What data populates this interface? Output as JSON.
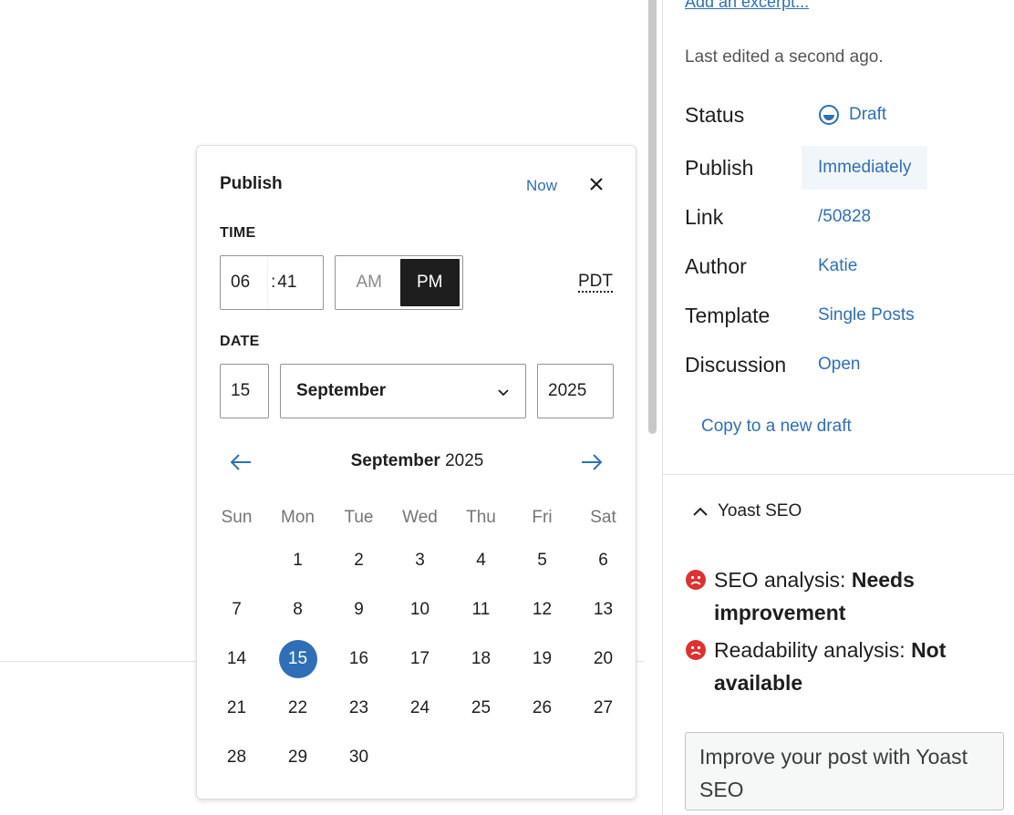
{
  "sidebar": {
    "excerpt_link": "Add an excerpt...",
    "last_edited": "Last edited a second ago.",
    "rows": [
      {
        "label": "Status",
        "value": "Draft"
      },
      {
        "label": "Publish",
        "value": "Immediately"
      },
      {
        "label": "Link",
        "value": "/50828"
      },
      {
        "label": "Author",
        "value": "Katie"
      },
      {
        "label": "Template",
        "value": "Single Posts"
      },
      {
        "label": "Discussion",
        "value": "Open"
      }
    ],
    "copy_draft": "Copy to a new draft",
    "yoast": {
      "title": "Yoast SEO",
      "seo_prefix": "SEO analysis: ",
      "seo_value": "Needs improvement",
      "readability_prefix": "Readability analysis: ",
      "readability_value": "Not available",
      "improve_button": "Improve your post with Yoast SEO"
    }
  },
  "popover": {
    "title": "Publish",
    "now": "Now",
    "time_label": "TIME",
    "hour": "06",
    "minute": "41",
    "am": "AM",
    "pm": "PM",
    "selected_period": "PM",
    "timezone": "PDT",
    "date_label": "DATE",
    "day": "15",
    "month": "September",
    "year": "2025",
    "calendar": {
      "month": "September",
      "year": "2025",
      "weekdays": [
        "Sun",
        "Mon",
        "Tue",
        "Wed",
        "Thu",
        "Fri",
        "Sat"
      ],
      "weeks": [
        [
          "",
          "1",
          "2",
          "3",
          "4",
          "5",
          "6"
        ],
        [
          "7",
          "8",
          "9",
          "10",
          "11",
          "12",
          "13"
        ],
        [
          "14",
          "15",
          "16",
          "17",
          "18",
          "19",
          "20"
        ],
        [
          "21",
          "22",
          "23",
          "24",
          "25",
          "26",
          "27"
        ],
        [
          "28",
          "29",
          "30",
          "",
          "",
          "",
          ""
        ]
      ],
      "selected_day": "15"
    }
  },
  "colors": {
    "accent": "#2f6fb5",
    "text": "#1e1e1e",
    "yoast_red": "#dc3232"
  }
}
